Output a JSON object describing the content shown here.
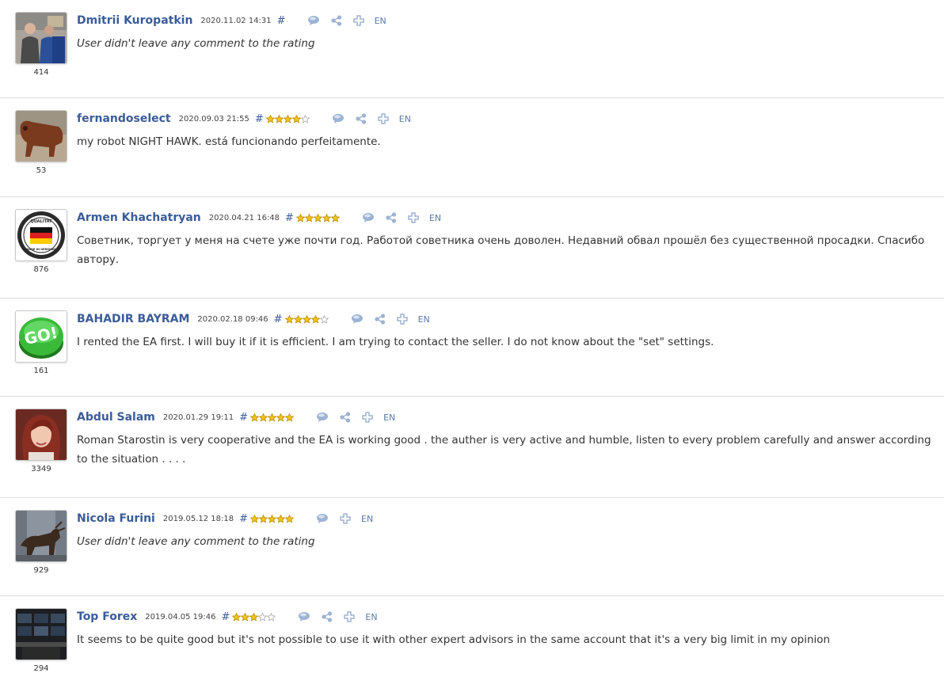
{
  "reviews": [
    {
      "author": "Dmitrii Kuropatkin",
      "date": "2020.11.02 14:31",
      "hash": "#",
      "rating": 0,
      "show_stars": false,
      "rank": "414",
      "text": "User didn't leave any comment to the rating",
      "italic": true,
      "has_share": true,
      "lang": "EN",
      "avatar": "men-photo"
    },
    {
      "author": "fernandoselect",
      "date": "2020.09.03 21:55",
      "hash": "#",
      "rating": 4,
      "show_stars": true,
      "rank": "53",
      "text": "my robot NIGHT HAWK. está funcionando perfeitamente.",
      "italic": false,
      "has_share": true,
      "lang": "EN",
      "avatar": "cow-photo"
    },
    {
      "author": "Armen Khachatryan",
      "date": "2020.04.21 16:48",
      "hash": "#",
      "rating": 5,
      "show_stars": true,
      "rank": "876",
      "text": "Советник, торгует у меня на счете уже почти год. Работой советника очень доволен. Недавний обвал прошёл без существенной просадки. Спасибо автору.",
      "italic": false,
      "has_share": true,
      "lang": "EN",
      "avatar": "quality-badge",
      "badge_top": "QUALITAT",
      "badge_bottom": "MADE IN GERMANY"
    },
    {
      "author": "BAHADIR BAYRAM",
      "date": "2020.02.18 09:46",
      "hash": "#",
      "rating": 4,
      "show_stars": true,
      "rank": "161",
      "text": "I rented the EA first. I will buy it if it is efficient. I am trying to contact the seller. I do not know about the \"set\" settings.",
      "italic": false,
      "has_share": true,
      "lang": "EN",
      "avatar": "go-button",
      "go_label": "GO!"
    },
    {
      "author": "Abdul Salam",
      "date": "2020.01.29 19:11",
      "hash": "#",
      "rating": 5,
      "show_stars": true,
      "rank": "3349",
      "text": "Roman Starostin is very cooperative and the EA is working good . the auther is very active and humble, listen to every problem carefully and answer according to the situation . . . .",
      "italic": false,
      "has_share": true,
      "lang": "EN",
      "avatar": "woman-photo"
    },
    {
      "author": "Nicola Furini",
      "date": "2019.05.12 18:18",
      "hash": "#",
      "rating": 5,
      "show_stars": true,
      "rank": "929",
      "text": "User didn't leave any comment to the rating",
      "italic": true,
      "has_share": false,
      "lang": "EN",
      "avatar": "bull-statue"
    },
    {
      "author": "Top Forex",
      "date": "2019.04.05 19:46",
      "hash": "#",
      "rating": 3,
      "show_stars": true,
      "rank": "294",
      "text": "It seems to be quite good but it's not possible to use it with other expert advisors in the same account that it's a very big limit in my opinion",
      "italic": false,
      "has_share": true,
      "lang": "EN",
      "avatar": "trading-desk"
    }
  ],
  "colors": {
    "author": "#3a5c99",
    "star_filled": "#f5c518",
    "star_empty": "#ffffff",
    "icon": "#9db3d3",
    "divider": "#dddddd"
  }
}
